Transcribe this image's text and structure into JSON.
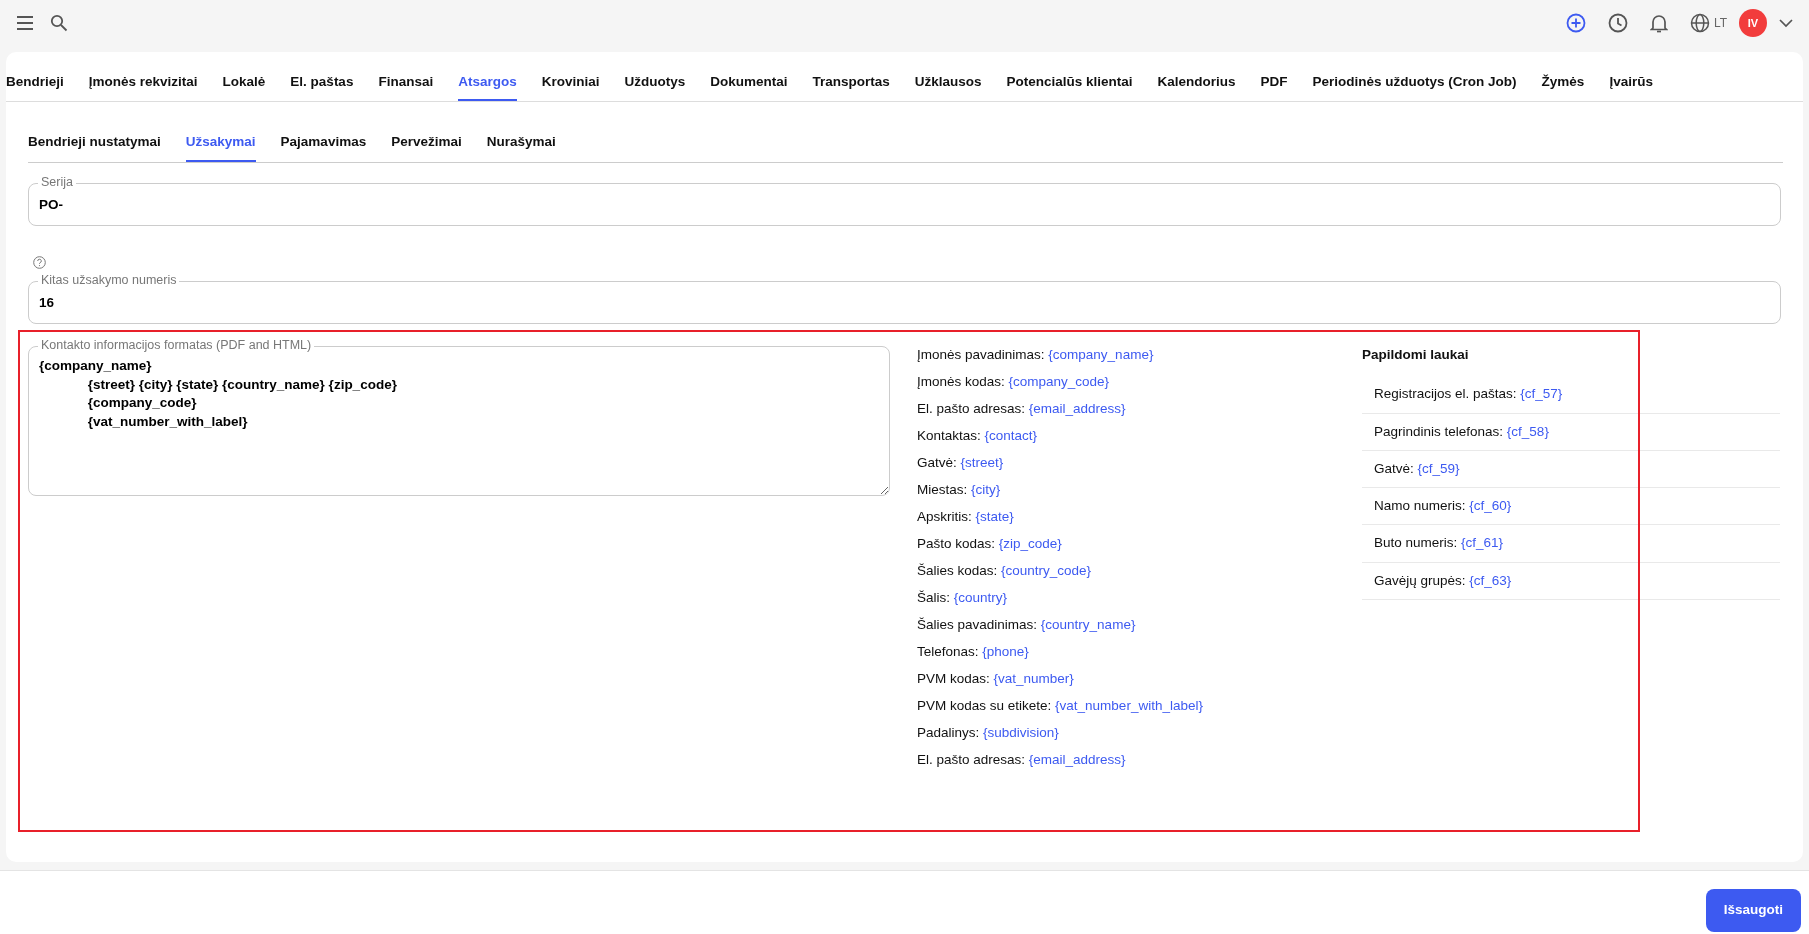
{
  "topbar": {
    "language": "LT",
    "avatar_initials": "IV"
  },
  "main_tabs": [
    {
      "label": "Bendrieji",
      "selected": false
    },
    {
      "label": "Įmonės rekvizitai",
      "selected": false
    },
    {
      "label": "Lokalė",
      "selected": false
    },
    {
      "label": "El. paštas",
      "selected": false
    },
    {
      "label": "Finansai",
      "selected": false
    },
    {
      "label": "Atsargos",
      "selected": true
    },
    {
      "label": "Kroviniai",
      "selected": false
    },
    {
      "label": "Užduotys",
      "selected": false
    },
    {
      "label": "Dokumentai",
      "selected": false
    },
    {
      "label": "Transportas",
      "selected": false
    },
    {
      "label": "Užklausos",
      "selected": false
    },
    {
      "label": "Potencialūs klientai",
      "selected": false
    },
    {
      "label": "Kalendorius",
      "selected": false
    },
    {
      "label": "PDF",
      "selected": false
    },
    {
      "label": "Periodinės užduotys (Cron Job)",
      "selected": false
    },
    {
      "label": "Žymės",
      "selected": false
    },
    {
      "label": "Įvairūs",
      "selected": false
    }
  ],
  "sub_tabs": [
    {
      "label": "Bendrieji nustatymai",
      "selected": false
    },
    {
      "label": "Užsakymai",
      "selected": true
    },
    {
      "label": "Pajamavimas",
      "selected": false
    },
    {
      "label": "Pervežimai",
      "selected": false
    },
    {
      "label": "Nurašymai",
      "selected": false
    }
  ],
  "fields": [
    {
      "label": "Serija",
      "value": "PO-",
      "help": false
    },
    {
      "label": "Kitas užsakymo numeris",
      "value": "16",
      "help": true
    }
  ],
  "contact_format": {
    "label": "Kontakto informacijos formatas (PDF and HTML)",
    "value": "{company_name}\n\t{street} {city} {state} {country_name} {zip_code}\n\t{company_code}\n\t{vat_number_with_label}"
  },
  "merge_fields": [
    {
      "label": "Įmonės pavadinimas:",
      "value": "{company_name}"
    },
    {
      "label": "Įmonės kodas:",
      "value": "{company_code}"
    },
    {
      "label": "El. pašto adresas:",
      "value": "{email_address}"
    },
    {
      "label": "Kontaktas:",
      "value": "{contact}"
    },
    {
      "label": "Gatvė:",
      "value": "{street}"
    },
    {
      "label": "Miestas:",
      "value": "{city}"
    },
    {
      "label": "Apskritis:",
      "value": "{state}"
    },
    {
      "label": "Pašto kodas:",
      "value": "{zip_code}"
    },
    {
      "label": "Šalies kodas:",
      "value": "{country_code}"
    },
    {
      "label": "Šalis:",
      "value": "{country}"
    },
    {
      "label": "Šalies pavadinimas:",
      "value": "{country_name}"
    },
    {
      "label": "Telefonas:",
      "value": "{phone}"
    },
    {
      "label": "PVM kodas:",
      "value": "{vat_number}"
    },
    {
      "label": "PVM kodas su etikete:",
      "value": "{vat_number_with_label}"
    },
    {
      "label": "Padalinys:",
      "value": "{subdivision}"
    },
    {
      "label": "El. pašto adresas:",
      "value": "{email_address}"
    }
  ],
  "custom_fields": {
    "title": "Papildomi laukai",
    "items": [
      {
        "label": "Registracijos el. paštas:",
        "value": "{cf_57}"
      },
      {
        "label": "Pagrindinis telefonas:",
        "value": "{cf_58}"
      },
      {
        "label": "Gatvė:",
        "value": "{cf_59}"
      },
      {
        "label": "Namo numeris:",
        "value": "{cf_60}"
      },
      {
        "label": "Buto numeris:",
        "value": "{cf_61}"
      },
      {
        "label": "Gavėjų grupės:",
        "value": "{cf_63}"
      }
    ]
  },
  "save_button": "Išsaugoti"
}
